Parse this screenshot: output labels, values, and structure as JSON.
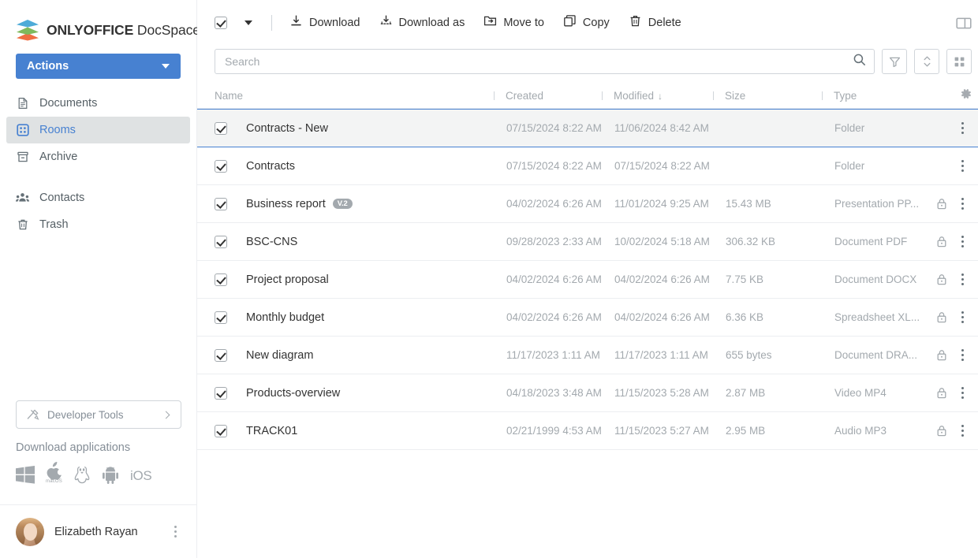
{
  "brand": {
    "bold": "ONLYOFFICE",
    "light": " DocSpace"
  },
  "sidebar": {
    "actions_button": "Actions",
    "nav": [
      {
        "label": "Documents",
        "icon": "document-icon",
        "active": false
      },
      {
        "label": "Rooms",
        "icon": "rooms-grid-icon",
        "active": true
      },
      {
        "label": "Archive",
        "icon": "archive-icon",
        "active": false
      },
      {
        "label": "Contacts",
        "icon": "contacts-people-icon",
        "active": false
      },
      {
        "label": "Trash",
        "icon": "trash-icon",
        "active": false
      }
    ],
    "developer_tools": "Developer Tools",
    "download_title": "Download applications",
    "download_apps": [
      {
        "name": "windows-icon",
        "caption": ""
      },
      {
        "name": "apple-macos-icon",
        "caption": "macOS"
      },
      {
        "name": "linux-penguin-icon",
        "caption": ""
      },
      {
        "name": "android-icon",
        "caption": ""
      },
      {
        "name": "ios-text-icon",
        "caption": "iOS"
      }
    ],
    "profile_name": "Elizabeth Rayan"
  },
  "toolbar": {
    "buttons": [
      {
        "label": "Download",
        "icon": "download-icon"
      },
      {
        "label": "Download as",
        "icon": "download-as-icon"
      },
      {
        "label": "Move to",
        "icon": "move-to-icon"
      },
      {
        "label": "Copy",
        "icon": "copy-icon"
      },
      {
        "label": "Delete",
        "icon": "trash-icon"
      }
    ]
  },
  "search": {
    "placeholder": "Search",
    "value": "",
    "buttons": [
      "filter-icon",
      "sort-icon",
      "grid-view-icon"
    ]
  },
  "table": {
    "columns": [
      {
        "key": "name",
        "label": "Name",
        "sort": ""
      },
      {
        "key": "created",
        "label": "Created",
        "sort": ""
      },
      {
        "key": "modified",
        "label": "Modified",
        "sort": "↓"
      },
      {
        "key": "size",
        "label": "Size",
        "sort": ""
      },
      {
        "key": "type",
        "label": "Type",
        "sort": ""
      }
    ],
    "rows": [
      {
        "name": "Contracts - New",
        "badge": "",
        "created": "07/15/2024 8:22 AM",
        "modified": "11/06/2024 8:42 AM",
        "size": "",
        "type": "Folder",
        "locked": false,
        "checked": true,
        "highlight": true
      },
      {
        "name": "Contracts",
        "badge": "",
        "created": "07/15/2024 8:22 AM",
        "modified": "07/15/2024 8:22 AM",
        "size": "",
        "type": "Folder",
        "locked": false,
        "checked": true,
        "highlight": false
      },
      {
        "name": "Business report",
        "badge": "V.2",
        "created": "04/02/2024 6:26 AM",
        "modified": "11/01/2024 9:25 AM",
        "size": "15.43 MB",
        "type": "Presentation PP...",
        "locked": true,
        "checked": true,
        "highlight": false
      },
      {
        "name": "BSC-CNS",
        "badge": "",
        "created": "09/28/2023 2:33 AM",
        "modified": "10/02/2024 5:18 AM",
        "size": "306.32 KB",
        "type": "Document PDF",
        "locked": true,
        "checked": true,
        "highlight": false
      },
      {
        "name": "Project proposal",
        "badge": "",
        "created": "04/02/2024 6:26 AM",
        "modified": "04/02/2024 6:26 AM",
        "size": "7.75 KB",
        "type": "Document DOCX",
        "locked": true,
        "checked": true,
        "highlight": false
      },
      {
        "name": "Monthly budget",
        "badge": "",
        "created": "04/02/2024 6:26 AM",
        "modified": "04/02/2024 6:26 AM",
        "size": "6.36 KB",
        "type": "Spreadsheet XL...",
        "locked": true,
        "checked": true,
        "highlight": false
      },
      {
        "name": "New diagram",
        "badge": "",
        "created": "11/17/2023 1:11 AM",
        "modified": "11/17/2023 1:11 AM",
        "size": "655 bytes",
        "type": "Document DRA...",
        "locked": true,
        "checked": true,
        "highlight": false
      },
      {
        "name": "Products-overview",
        "badge": "",
        "created": "04/18/2023 3:48 AM",
        "modified": "11/15/2023 5:28 AM",
        "size": "2.87 MB",
        "type": "Video MP4",
        "locked": true,
        "checked": true,
        "highlight": false
      },
      {
        "name": "TRACK01",
        "badge": "",
        "created": "02/21/1999 4:53 AM",
        "modified": "11/15/2023 5:27 AM",
        "size": "2.95 MB",
        "type": "Audio MP3",
        "locked": true,
        "checked": true,
        "highlight": false
      }
    ]
  },
  "colors": {
    "accent": "#4781d1",
    "muted": "#a3a9ae",
    "text": "#333333",
    "border": "#eceef1"
  }
}
